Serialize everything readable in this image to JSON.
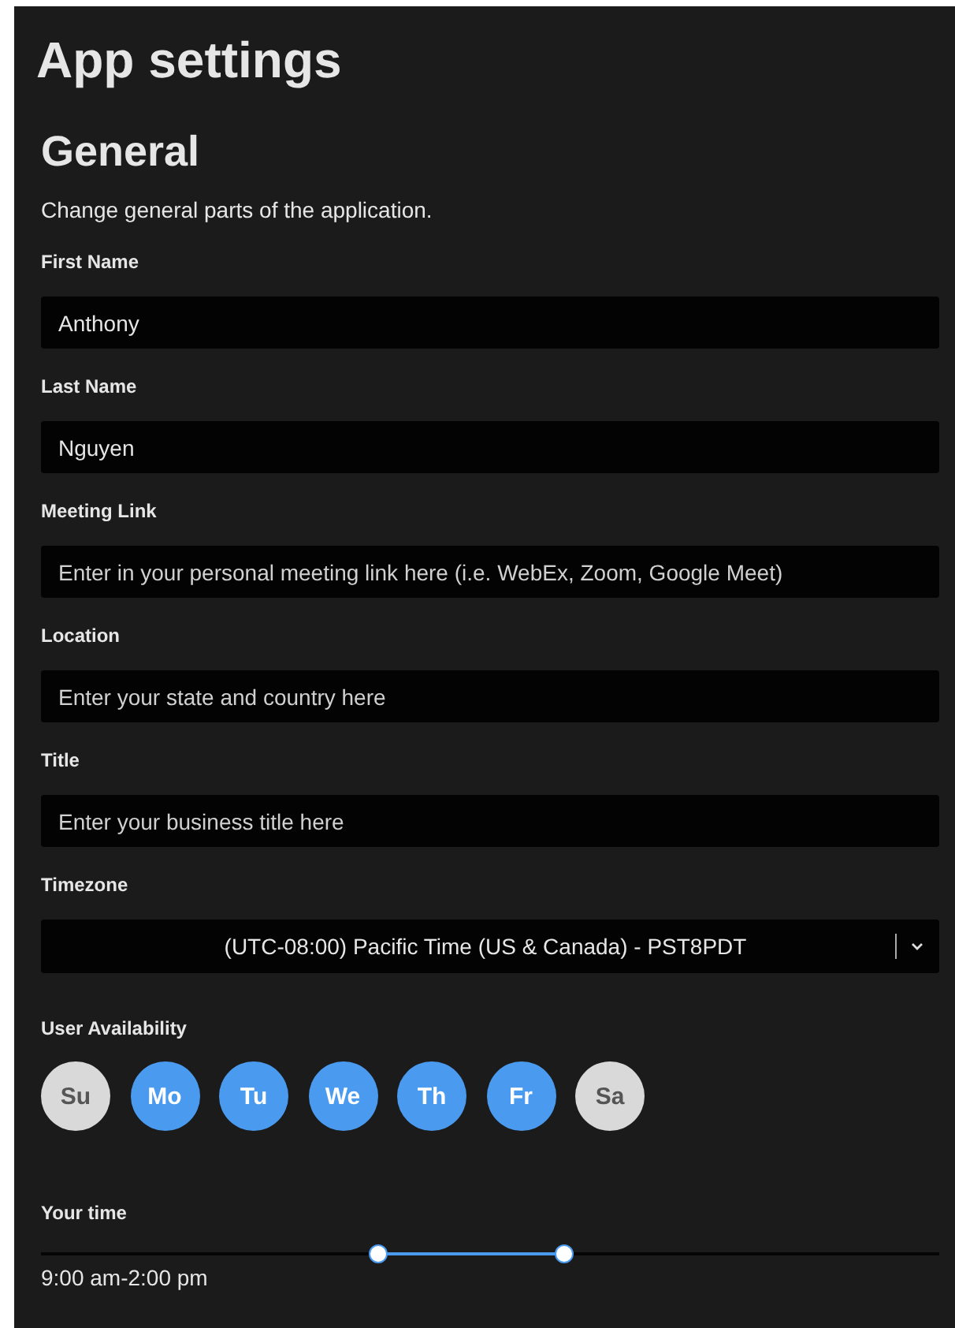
{
  "title": "App settings",
  "section": {
    "heading": "General",
    "description": "Change general parts of the application."
  },
  "fields": [
    {
      "label": "First Name",
      "value": "Anthony"
    },
    {
      "label": "Last Name",
      "value": "Nguyen"
    },
    {
      "label": "Meeting Link",
      "placeholder": "Enter in your personal meeting link here (i.e. WebEx, Zoom, Google Meet)"
    },
    {
      "label": "Location",
      "placeholder": "Enter your state and country here"
    },
    {
      "label": "Title",
      "placeholder": "Enter your business title here"
    }
  ],
  "timezone": {
    "label": "Timezone",
    "value": "(UTC-08:00) Pacific Time (US & Canada) - PST8PDT"
  },
  "availability": {
    "label": "User Availability",
    "days": [
      {
        "label": "Su",
        "selected": false
      },
      {
        "label": "Mo",
        "selected": true
      },
      {
        "label": "Tu",
        "selected": true
      },
      {
        "label": "We",
        "selected": true
      },
      {
        "label": "Th",
        "selected": true
      },
      {
        "label": "Fr",
        "selected": true
      },
      {
        "label": "Sa",
        "selected": false
      }
    ]
  },
  "time": {
    "label": "Your time",
    "thumbs": [
      {
        "level": 0.375
      },
      {
        "level": 0.583
      }
    ],
    "reading": "9:00 am-2:00 pm"
  }
}
